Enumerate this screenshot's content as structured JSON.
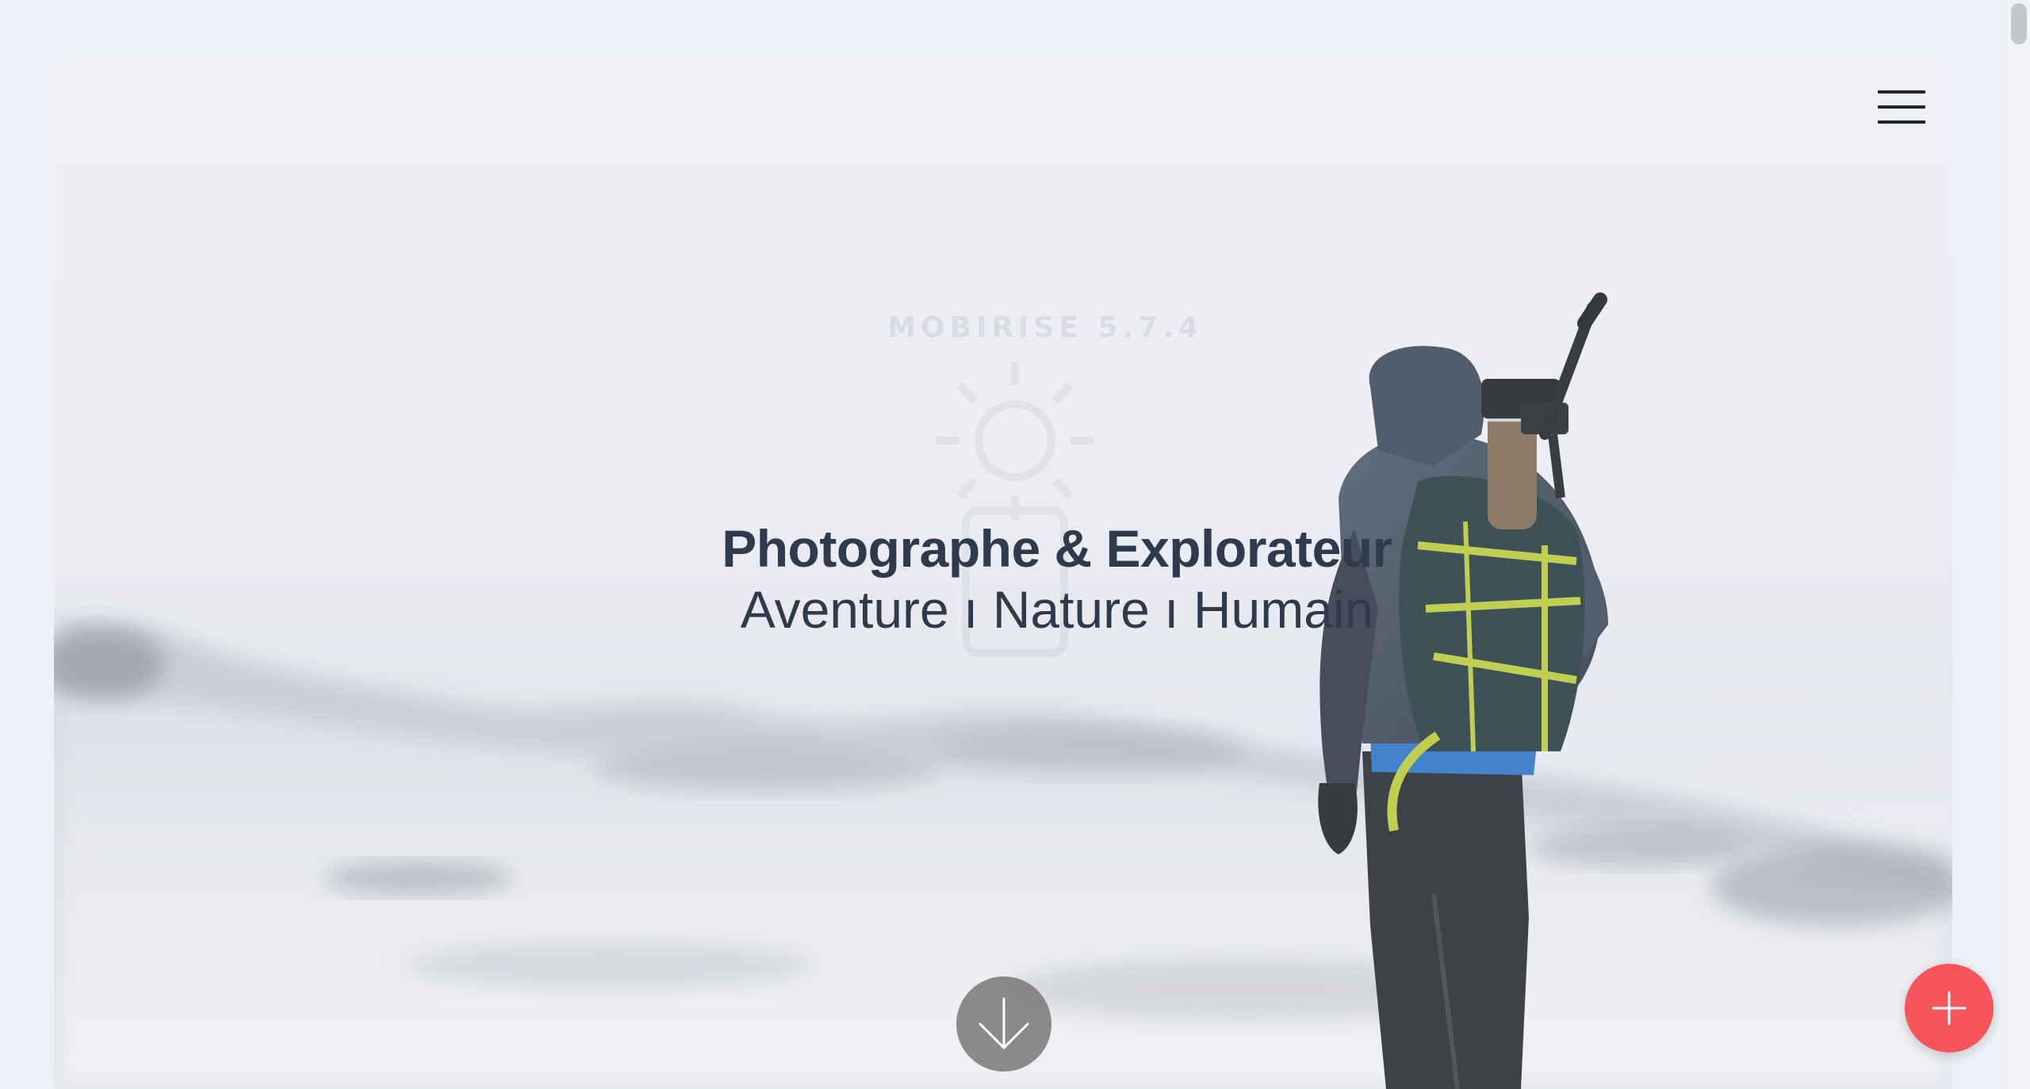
{
  "hero": {
    "watermark": "MOBIRISE 5.7.4",
    "title": "Photographe & Explorateur",
    "subtitle": "Aventure ı Nature ı Humain"
  },
  "icons": {
    "menu": "hamburger-menu-icon",
    "scroll_down": "arrow-down-icon",
    "add": "plus-icon",
    "watermark_logo": "sun-icon"
  },
  "colors": {
    "page_background": "#eef0f7",
    "title_text": "#2e3a4d",
    "fab_background": "#f8545c",
    "scroll_button": "#78787a"
  }
}
